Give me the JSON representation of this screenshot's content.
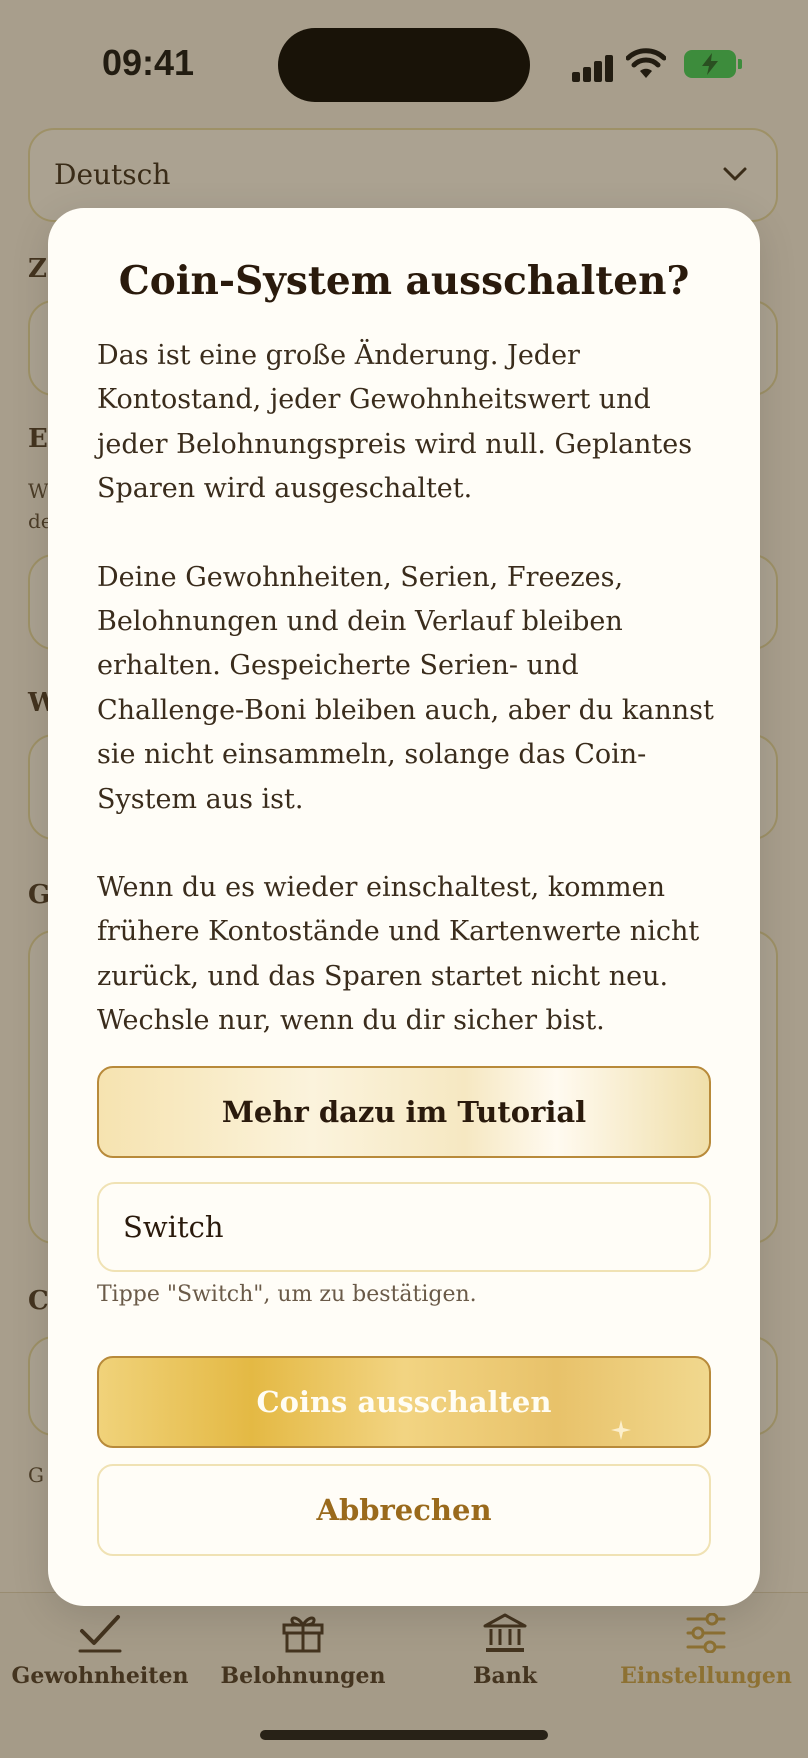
{
  "status_bar": {
    "time": "09:41"
  },
  "background": {
    "language_value": "Deutsch",
    "section_letters": [
      "Z",
      "E",
      "W",
      "G",
      "C"
    ],
    "small_letters": [
      "W",
      "de",
      "G"
    ]
  },
  "modal": {
    "title": "Coin-System ausschalten?",
    "paragraphs": [
      "Das ist eine große Änderung. Jeder Kontostand, jeder Gewohnheitswert und jeder Belohnungspreis wird null. Geplantes Sparen wird ausgeschaltet.",
      "Deine Gewohnheiten, Serien, Freezes, Belohnungen und dein Verlauf bleiben erhalten. Gespeicherte Serien- und Challenge-Boni bleiben auch, aber du kannst sie nicht einsammeln, solange das Coin-System aus ist.",
      "Wenn du es wieder einschaltest, kommen frühere Kontostände und Kartenwerte nicht zurück, und das Sparen startet nicht neu. Wechsle nur, wenn du dir sicher bist."
    ],
    "tutorial_button": "Mehr dazu im Tutorial",
    "confirm_input_value": "Switch",
    "helper_text": "Tippe \"Switch\", um zu bestätigen.",
    "confirm_button": "Coins ausschalten",
    "cancel_button": "Abbrechen"
  },
  "tab_bar": {
    "tabs": [
      {
        "label": "Gewohnheiten",
        "icon": "checkmark-icon"
      },
      {
        "label": "Belohnungen",
        "icon": "gift-icon"
      },
      {
        "label": "Bank",
        "icon": "bank-icon"
      },
      {
        "label": "Einstellungen",
        "icon": "sliders-icon"
      }
    ],
    "active_index": 3
  },
  "colors": {
    "accent_gold": "#c9a24a",
    "confirm_gradient_mid": "#e4b944",
    "cancel_text": "#9a6a1c",
    "battery": "#3ed05a"
  }
}
